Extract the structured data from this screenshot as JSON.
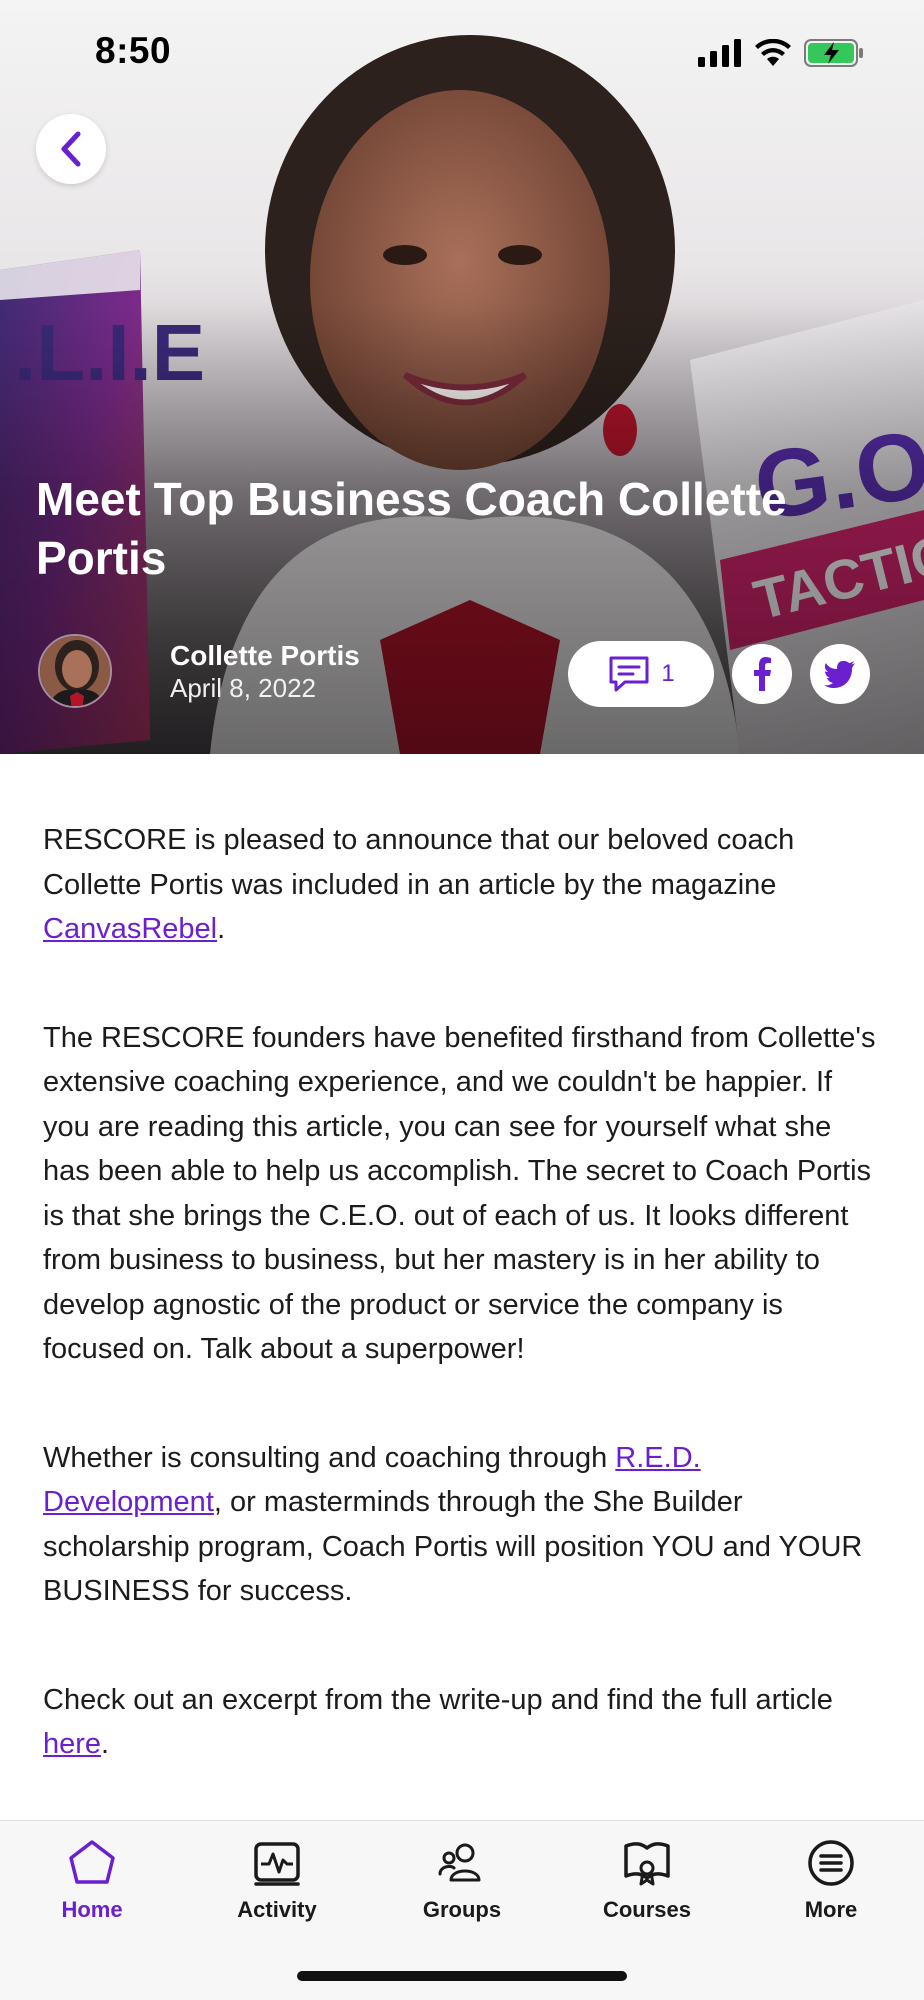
{
  "status_bar": {
    "time": "8:50"
  },
  "article": {
    "title": "Meet Top Business Coach Collette Portis",
    "author": "Collette Portis",
    "date": "April 8, 2022",
    "comment_count": "1",
    "paragraphs": {
      "p1_before": "RESCORE is pleased to announce that our beloved coach Collette Portis was included in an article by the magazine ",
      "p1_link": "CanvasRebel",
      "p1_after": ".",
      "p2": "The RESCORE founders have benefited firsthand from Collette's extensive coaching experience, and we couldn't be happier. If you are reading this article, you can see for yourself what she has been able to help us accomplish. The secret to Coach Portis is that she brings the C.E.O. out of each of us. It looks different from business to business, but her mastery is in her ability to develop agnostic of the product or service the company is focused on. Talk about a superpower!",
      "p3_before": "Whether is consulting and coaching through ",
      "p3_link": "R.E.D. Development",
      "p3_after": ", or masterminds through the She Builder scholarship program, Coach Portis will position YOU and YOUR BUSINESS for success.",
      "p4_before": "Check out an excerpt from the write-up and find the full article ",
      "p4_link": "here",
      "p4_after": "."
    }
  },
  "tabbar": {
    "items": [
      {
        "label": "Home",
        "icon": "home-icon",
        "active": true
      },
      {
        "label": "Activity",
        "icon": "activity-icon",
        "active": false
      },
      {
        "label": "Groups",
        "icon": "groups-icon",
        "active": false
      },
      {
        "label": "Courses",
        "icon": "courses-icon",
        "active": false
      },
      {
        "label": "More",
        "icon": "more-icon",
        "active": false
      }
    ]
  },
  "colors": {
    "accent": "#6a1fd1",
    "battery": "#34c759",
    "twitter": "#6a1fd1"
  }
}
